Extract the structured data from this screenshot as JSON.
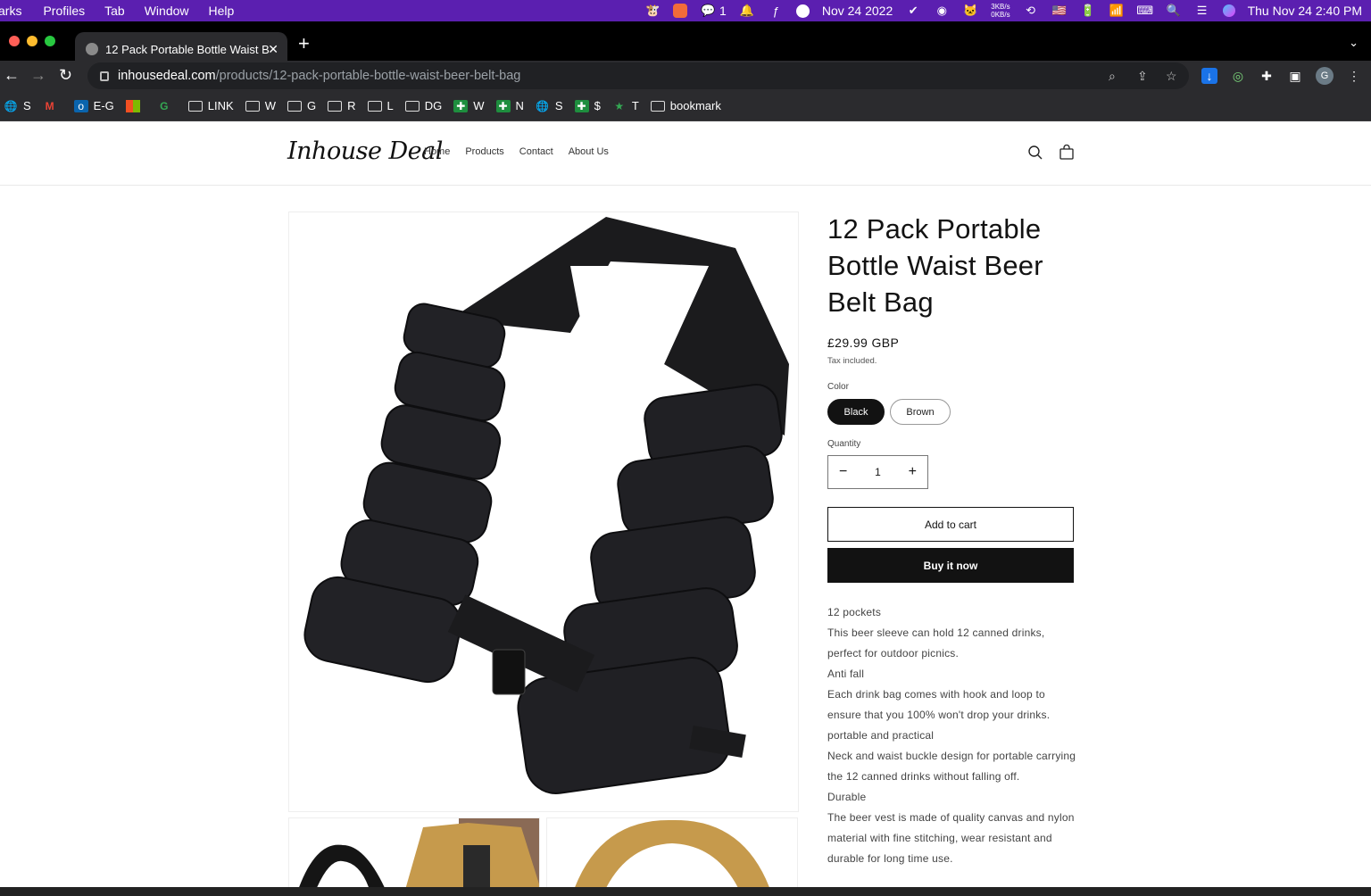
{
  "menubar": {
    "items": [
      "arks",
      "Profiles",
      "Tab",
      "Window",
      "Help"
    ],
    "wechat_count": "1",
    "date_widget": "Nov 24 2022",
    "net_up": "3KB/s",
    "net_down": "0KB/s",
    "clock": "Thu Nov 24  2:40 PM"
  },
  "browser": {
    "tab_title": "12 Pack Portable Bottle Waist B",
    "url_host": "inhousedeal.com",
    "url_path": "/products/12-pack-portable-bottle-waist-beer-belt-bag",
    "avatar_letter": "G",
    "bookmarks": [
      {
        "label": "S",
        "icon": "globe-icon"
      },
      {
        "label": "",
        "icon": "gmail-icon"
      },
      {
        "label": "E-G",
        "icon": "outlook-icon"
      },
      {
        "label": "",
        "icon": "microsoft-icon"
      },
      {
        "label": "",
        "icon": "g-icon"
      },
      {
        "label": "LINK",
        "icon": "folder-icon"
      },
      {
        "label": "W",
        "icon": "folder-icon"
      },
      {
        "label": "G",
        "icon": "folder-icon"
      },
      {
        "label": "R",
        "icon": "folder-icon"
      },
      {
        "label": "L",
        "icon": "folder-icon"
      },
      {
        "label": "DG",
        "icon": "folder-icon"
      },
      {
        "label": "W",
        "icon": "cross-icon"
      },
      {
        "label": "N",
        "icon": "cross-icon"
      },
      {
        "label": "S",
        "icon": "globe-icon"
      },
      {
        "label": "$",
        "icon": "cross-icon"
      },
      {
        "label": "T",
        "icon": "star-icon"
      },
      {
        "label": "bookmark",
        "icon": "folder-icon"
      }
    ]
  },
  "site": {
    "logo": "Inhouse Deal",
    "nav": [
      "Home",
      "Products",
      "Contact",
      "About Us"
    ]
  },
  "product": {
    "title": "12 Pack Portable Bottle Waist Beer Belt Bag",
    "price": "£29.99 GBP",
    "tax_note": "Tax included.",
    "color_label": "Color",
    "colors": [
      "Black",
      "Brown"
    ],
    "selected_color": "Black",
    "quantity_label": "Quantity",
    "quantity": "1",
    "add_to_cart": "Add to cart",
    "buy_now": "Buy it now",
    "description": [
      "12 pockets",
      "This beer sleeve can hold 12 canned drinks, perfect for outdoor picnics.",
      "Anti fall",
      "Each drink bag comes with hook and loop to ensure that you 100% won't drop your drinks.",
      "portable and practical",
      "Neck and waist buckle design for portable carrying the 12 canned drinks without falling off.",
      "Durable",
      "The beer vest is made of quality canvas and nylon material with fine stitching, wear resistant and durable for long time use."
    ]
  },
  "colors": {
    "menubar_bg": "#5b1fb0",
    "browser_bg": "#2b2b2e",
    "accent": "#121212"
  }
}
